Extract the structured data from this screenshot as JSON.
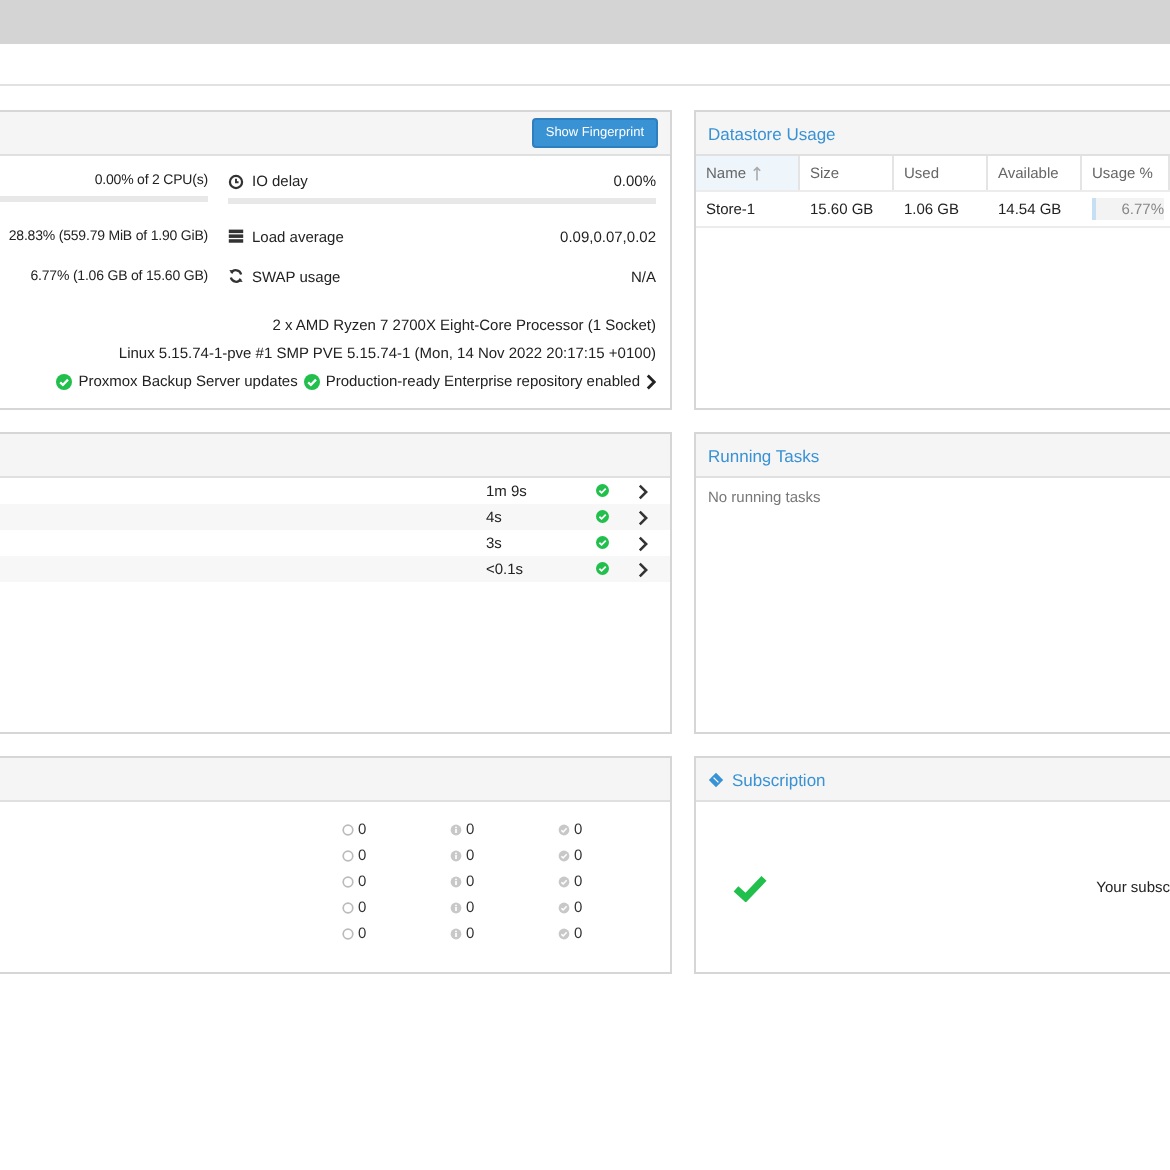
{
  "status_panel": {
    "button": "Show Fingerprint",
    "left_stats": [
      {
        "value": "0.00% of 2 CPU(s)"
      },
      {
        "value": "28.83% (559.79 MiB of 1.90 GiB)"
      },
      {
        "value": "6.77% (1.06 GB of 15.60 GB)"
      }
    ],
    "right_stats": [
      {
        "kind": "clock",
        "label": "IO delay",
        "value": "0.00%"
      },
      {
        "kind": "load",
        "label": "Load average",
        "value": "0.09,0.07,0.02"
      },
      {
        "kind": "swap",
        "label": "SWAP usage",
        "value": "N/A"
      }
    ],
    "info_lines": [
      "2 x AMD Ryzen 7 2700X Eight-Core Processor (1 Socket)",
      "Linux 5.15.74-1-pve #1 SMP PVE 5.15.74-1 (Mon, 14 Nov 2022 20:17:15 +0100)"
    ],
    "updates": [
      {
        "label": "Proxmox Backup Server updates",
        "ok": true
      },
      {
        "label": "Production-ready Enterprise repository enabled",
        "ok": true
      }
    ]
  },
  "datastore_usage": {
    "title": "Datastore Usage",
    "columns": [
      {
        "label": "Name",
        "sorted": true
      },
      {
        "label": "Size",
        "sorted": false
      },
      {
        "label": "Used",
        "sorted": false
      },
      {
        "label": "Available",
        "sorted": false
      },
      {
        "label": "Usage %",
        "sorted": false
      }
    ],
    "rows": [
      {
        "name": "Store-1",
        "size": "15.60 GB",
        "used": "1.06 GB",
        "available": "14.54 GB",
        "usage": "6.77%",
        "level": 0.0677
      }
    ]
  },
  "tasks_panel": {
    "rows": [
      {
        "duration": "1m 9s",
        "ok": true
      },
      {
        "duration": "4s",
        "ok": true
      },
      {
        "duration": "3s",
        "ok": true
      },
      {
        "duration": "<0.1s",
        "ok": true
      }
    ]
  },
  "running_tasks": {
    "title": "Running Tasks",
    "empty_text": "No running tasks"
  },
  "counts_panel": {
    "rows": [
      {
        "counts": [
          "0",
          "0",
          "0"
        ]
      },
      {
        "counts": [
          "0",
          "0",
          "0"
        ]
      },
      {
        "counts": [
          "0",
          "0",
          "0"
        ]
      },
      {
        "counts": [
          "0",
          "0",
          "0"
        ]
      },
      {
        "counts": [
          "0",
          "0",
          "0"
        ]
      }
    ]
  },
  "subscription": {
    "title": "Subscription",
    "ok": true,
    "text": "Your subsc"
  }
}
